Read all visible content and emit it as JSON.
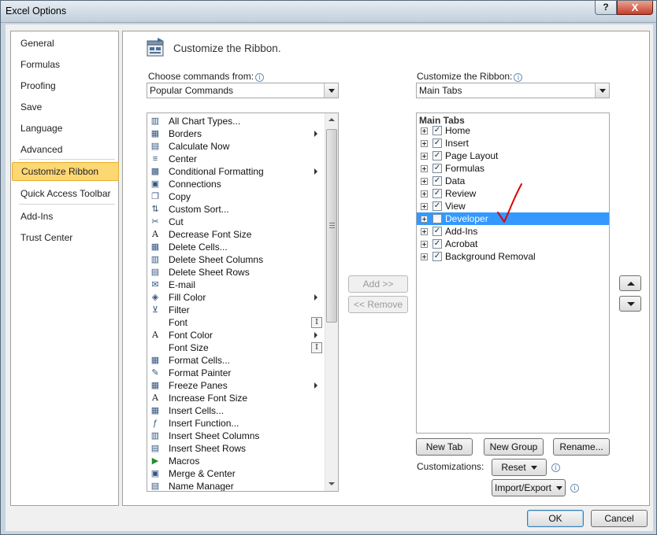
{
  "window": {
    "title": "Excel Options",
    "help": "?",
    "close": "X"
  },
  "nav": {
    "items": [
      {
        "label": "General"
      },
      {
        "label": "Formulas"
      },
      {
        "label": "Proofing"
      },
      {
        "label": "Save"
      },
      {
        "label": "Language"
      },
      {
        "label": "Advanced"
      },
      {
        "label": "Customize Ribbon"
      },
      {
        "label": "Quick Access Toolbar"
      },
      {
        "label": "Add-Ins"
      },
      {
        "label": "Trust Center"
      }
    ],
    "active": "Customize Ribbon"
  },
  "header": {
    "title": "Customize the Ribbon."
  },
  "left": {
    "label": "Choose commands from:",
    "combo_value": "Popular Commands",
    "commands": [
      {
        "label": "All Chart Types...",
        "icon": "chart-icon"
      },
      {
        "label": "Borders",
        "icon": "borders-icon"
      },
      {
        "label": "Calculate Now",
        "icon": "calculator-icon"
      },
      {
        "label": "Center",
        "icon": "align-center-icon"
      },
      {
        "label": "Conditional Formatting",
        "icon": "conditional-format-icon"
      },
      {
        "label": "Connections",
        "icon": "connections-icon"
      },
      {
        "label": "Copy",
        "icon": "copy-icon"
      },
      {
        "label": "Custom Sort...",
        "icon": "sort-icon"
      },
      {
        "label": "Cut",
        "icon": "scissors-icon"
      },
      {
        "label": "Decrease Font Size",
        "icon": "decrease-font-icon"
      },
      {
        "label": "Delete Cells...",
        "icon": "delete-cells-icon"
      },
      {
        "label": "Delete Sheet Columns",
        "icon": "delete-columns-icon"
      },
      {
        "label": "Delete Sheet Rows",
        "icon": "delete-rows-icon"
      },
      {
        "label": "E-mail",
        "icon": "email-icon"
      },
      {
        "label": "Fill Color",
        "icon": "fill-color-icon"
      },
      {
        "label": "Filter",
        "icon": "filter-icon"
      },
      {
        "label": "Font",
        "icon": "font-icon"
      },
      {
        "label": "Font Color",
        "icon": "font-color-icon"
      },
      {
        "label": "Font Size",
        "icon": "font-size-icon"
      },
      {
        "label": "Format Cells...",
        "icon": "format-cells-icon"
      },
      {
        "label": "Format Painter",
        "icon": "format-painter-icon"
      },
      {
        "label": "Freeze Panes",
        "icon": "freeze-panes-icon"
      },
      {
        "label": "Increase Font Size",
        "icon": "increase-font-icon"
      },
      {
        "label": "Insert Cells...",
        "icon": "insert-cells-icon"
      },
      {
        "label": "Insert Function...",
        "icon": "function-icon"
      },
      {
        "label": "Insert Sheet Columns",
        "icon": "insert-columns-icon"
      },
      {
        "label": "Insert Sheet Rows",
        "icon": "insert-rows-icon"
      },
      {
        "label": "Macros",
        "icon": "macros-icon"
      },
      {
        "label": "Merge & Center",
        "icon": "merge-center-icon"
      },
      {
        "label": "Name Manager",
        "icon": "name-manager-icon"
      }
    ]
  },
  "middle": {
    "add": "Add >>",
    "remove": "<< Remove"
  },
  "right": {
    "label": "Customize the Ribbon:",
    "combo_value": "Main Tabs",
    "tree_header": "Main Tabs",
    "tabs": [
      {
        "label": "Home",
        "checked": true
      },
      {
        "label": "Insert",
        "checked": true
      },
      {
        "label": "Page Layout",
        "checked": true
      },
      {
        "label": "Formulas",
        "checked": true
      },
      {
        "label": "Data",
        "checked": true
      },
      {
        "label": "Review",
        "checked": true
      },
      {
        "label": "View",
        "checked": true
      },
      {
        "label": "Developer",
        "checked": false,
        "selected": true
      },
      {
        "label": "Add-Ins",
        "checked": true
      },
      {
        "label": "Acrobat",
        "checked": true
      },
      {
        "label": "Background Removal",
        "checked": true
      }
    ],
    "new_tab": "New Tab",
    "new_group": "New Group",
    "rename": "Rename...",
    "customizations_label": "Customizations:",
    "reset": "Reset",
    "import_export": "Import/Export"
  },
  "footer": {
    "ok": "OK",
    "cancel": "Cancel"
  },
  "colors": {
    "selection": "#3399ff",
    "nav_active": "#fcd773",
    "annotation": "#e00000"
  }
}
